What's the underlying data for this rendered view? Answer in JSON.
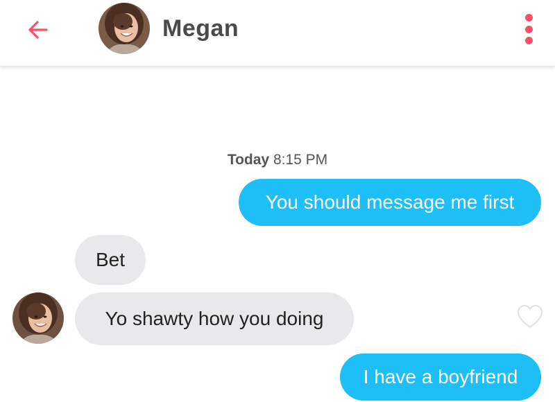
{
  "colors": {
    "accent": "#fd5068",
    "outgoing_bubble": "#1ebef7",
    "incoming_bubble": "#e9e9eb",
    "name_text": "#4a4a4a"
  },
  "header": {
    "back_icon": "arrow-left-icon",
    "contact_name": "Megan",
    "menu_icon": "vertical-dots-icon"
  },
  "conversation": {
    "timestamp_day": "Today",
    "timestamp_time": "8:15 PM",
    "messages": [
      {
        "direction": "outgoing",
        "text": "You should message me first"
      },
      {
        "direction": "incoming",
        "text": "Bet"
      },
      {
        "direction": "incoming",
        "text": "Yo shawty how you doing"
      },
      {
        "direction": "outgoing",
        "text": "I have a boyfriend"
      }
    ],
    "like_icon": "heart-outline-icon"
  }
}
